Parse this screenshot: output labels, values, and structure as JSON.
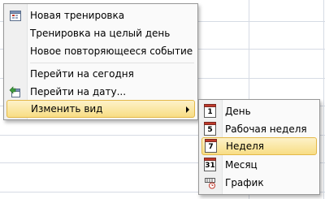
{
  "context_menu": {
    "items": [
      {
        "label": "Новая тренировка",
        "icon": "new-calendar-item-icon"
      },
      {
        "label": "Тренировка на целый день"
      },
      {
        "label": "Новое повторяющееся событие"
      },
      {
        "label": "Перейти на сегодня"
      },
      {
        "label": "Перейти на дату...",
        "icon": "goto-date-icon"
      },
      {
        "label": "Изменить вид",
        "has_submenu": true,
        "selected": true
      }
    ]
  },
  "view_submenu": {
    "items": [
      {
        "label": "День",
        "icon_text": "1",
        "icon": "day-view-icon"
      },
      {
        "label": "Рабочая неделя",
        "icon_text": "5",
        "icon": "work-week-view-icon"
      },
      {
        "label": "Неделя",
        "icon_text": "7",
        "icon": "week-view-icon",
        "selected": true
      },
      {
        "label": "Месяц",
        "icon_text": "31",
        "icon": "month-view-icon"
      },
      {
        "label": "График",
        "icon": "timeline-view-icon"
      }
    ]
  },
  "colors": {
    "highlight_top": "#fdf2c9",
    "highlight_bottom": "#f8dd84",
    "highlight_border": "#e3b849",
    "calendar_header": "#c0392b"
  }
}
